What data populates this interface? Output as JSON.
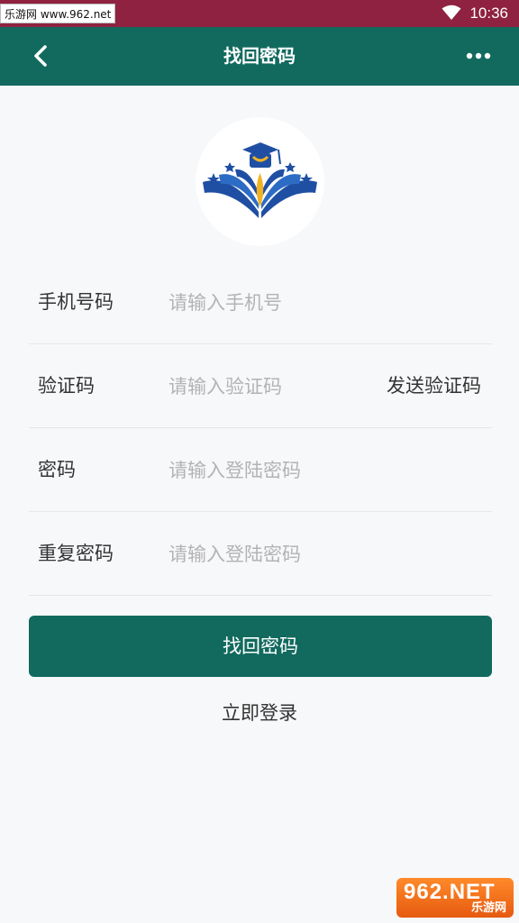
{
  "status_bar": {
    "time": "10:36",
    "watermark": "乐游网 www.962.net"
  },
  "header": {
    "title": "找回密码",
    "back_icon": "chevron-left-icon",
    "more_icon": "more-horizontal-icon"
  },
  "logo": {
    "icon": "education-book-cap-logo"
  },
  "form": {
    "phone": {
      "label": "手机号码",
      "placeholder": "请输入手机号"
    },
    "code": {
      "label": "验证码",
      "placeholder": "请输入验证码",
      "send_label": "发送验证码"
    },
    "password": {
      "label": "密码",
      "placeholder": "请输入登陆密码"
    },
    "confirm": {
      "label": "重复密码",
      "placeholder": "请输入登陆密码"
    }
  },
  "actions": {
    "submit_label": "找回密码",
    "login_label": "立即登录"
  },
  "watermark_bottom": {
    "number": "962.NET",
    "text": "乐游网"
  },
  "colors": {
    "primary": "#126a5e",
    "status_bar": "#8e2240",
    "background": "#f7f8fa"
  }
}
